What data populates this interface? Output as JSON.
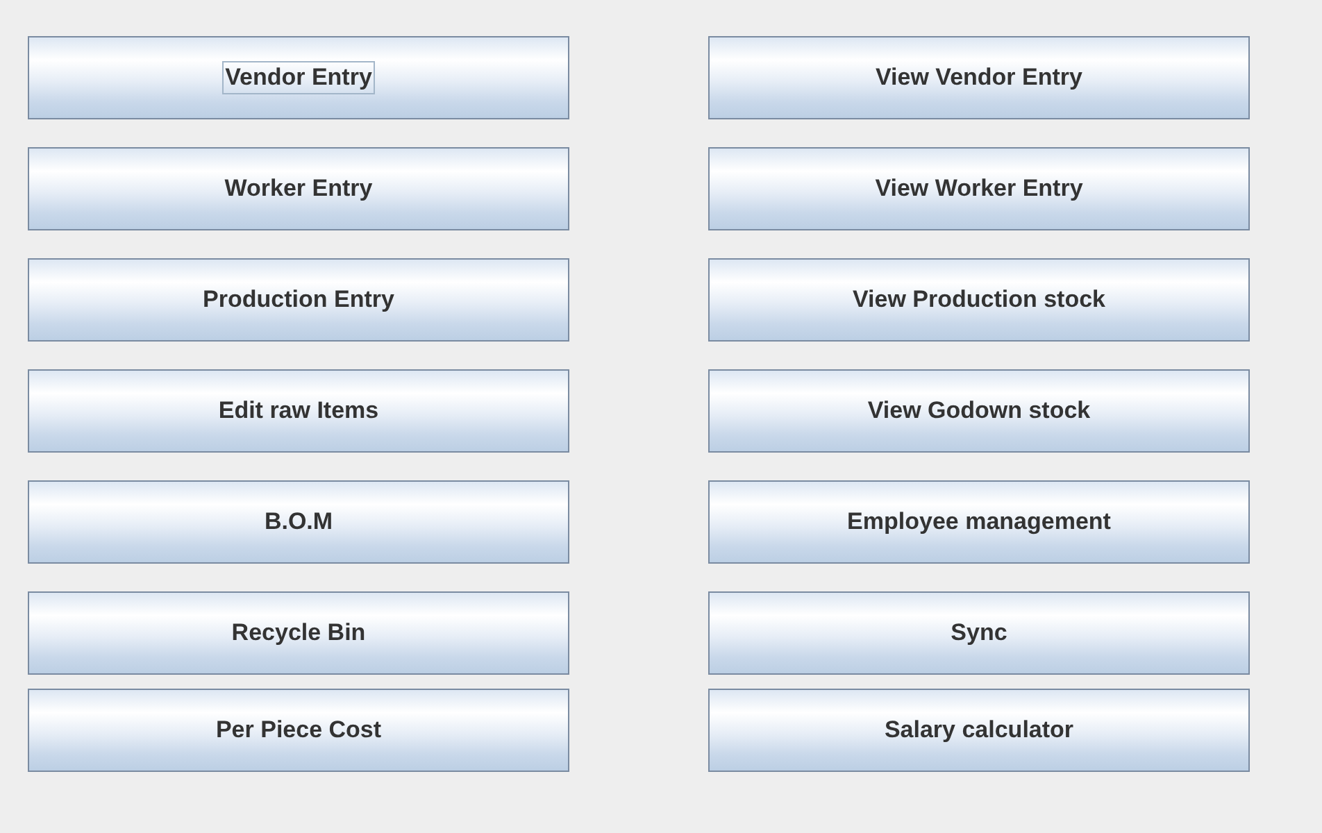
{
  "rows": [
    {
      "buttons": [
        {
          "label": "Vendor Entry",
          "focused": true
        },
        {
          "label": "View Vendor Entry",
          "focused": false
        }
      ]
    },
    {
      "buttons": [
        {
          "label": "Worker Entry",
          "focused": false
        },
        {
          "label": "View Worker Entry",
          "focused": false
        }
      ]
    },
    {
      "buttons": [
        {
          "label": "Production Entry",
          "focused": false
        },
        {
          "label": "View Production stock",
          "focused": false
        }
      ]
    },
    {
      "buttons": [
        {
          "label": "Edit raw Items",
          "focused": false
        },
        {
          "label": "View Godown stock",
          "focused": false
        }
      ]
    },
    {
      "buttons": [
        {
          "label": "B.O.M",
          "focused": false
        },
        {
          "label": "Employee management",
          "focused": false
        }
      ]
    },
    {
      "buttons": [
        {
          "label": "Recycle Bin",
          "focused": false
        },
        {
          "label": "Sync",
          "focused": false
        }
      ]
    },
    {
      "buttons": [
        {
          "label": "Per Piece Cost",
          "focused": false
        },
        {
          "label": "Salary calculator",
          "focused": false
        }
      ]
    }
  ]
}
